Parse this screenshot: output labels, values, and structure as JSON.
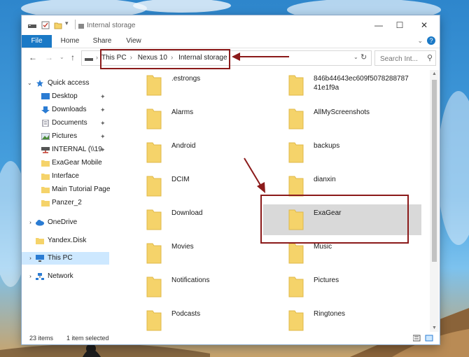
{
  "window": {
    "title": "Internal storage"
  },
  "ribbon": {
    "tabs": [
      "File",
      "Home",
      "Share",
      "View"
    ]
  },
  "address": {
    "crumbs": [
      "This PC",
      "Nexus 10",
      "Internal storage"
    ],
    "search_placeholder": "Search Int..."
  },
  "sidebar": {
    "items": [
      {
        "label": "Quick access",
        "icon": "star-icon",
        "pinned": false
      },
      {
        "label": "Desktop",
        "icon": "desktop-icon",
        "pinned": true
      },
      {
        "label": "Downloads",
        "icon": "download-icon",
        "pinned": true
      },
      {
        "label": "Documents",
        "icon": "document-icon",
        "pinned": true
      },
      {
        "label": "Pictures",
        "icon": "pictures-icon",
        "pinned": true
      },
      {
        "label": "INTERNAL (\\\\19",
        "icon": "network-drive-icon",
        "pinned": true
      },
      {
        "label": "ExaGear Mobile",
        "icon": "folder-icon",
        "pinned": false
      },
      {
        "label": "Interface",
        "icon": "folder-icon",
        "pinned": false
      },
      {
        "label": "Main Tutorial Page",
        "icon": "folder-icon",
        "pinned": false
      },
      {
        "label": "Panzer_2",
        "icon": "folder-icon",
        "pinned": false
      },
      {
        "label": "OneDrive",
        "icon": "cloud-icon",
        "pinned": false
      },
      {
        "label": "Yandex.Disk",
        "icon": "folder-icon",
        "pinned": false
      },
      {
        "label": "This PC",
        "icon": "computer-icon",
        "pinned": false
      },
      {
        "label": "Network",
        "icon": "network-icon",
        "pinned": false
      }
    ]
  },
  "folders": {
    "left": [
      ".estrongs",
      "Alarms",
      "Android",
      "DCIM",
      "Download",
      "Movies",
      "Notifications",
      "Podcasts"
    ],
    "right": [
      "846b44643ec609f5078288787 41e1f9a",
      "AllMyScreenshots",
      "backups",
      "dianxin",
      "ExaGear",
      "Music",
      "Pictures",
      "Ringtones"
    ]
  },
  "selected_folder": "ExaGear",
  "status": {
    "count": "23 items",
    "selection": "1 item selected"
  },
  "colors": {
    "accent": "#1a79c6",
    "annotation": "#8b1a1a",
    "folder": "#f5d36a",
    "selected_row": "#d9d9d9"
  }
}
